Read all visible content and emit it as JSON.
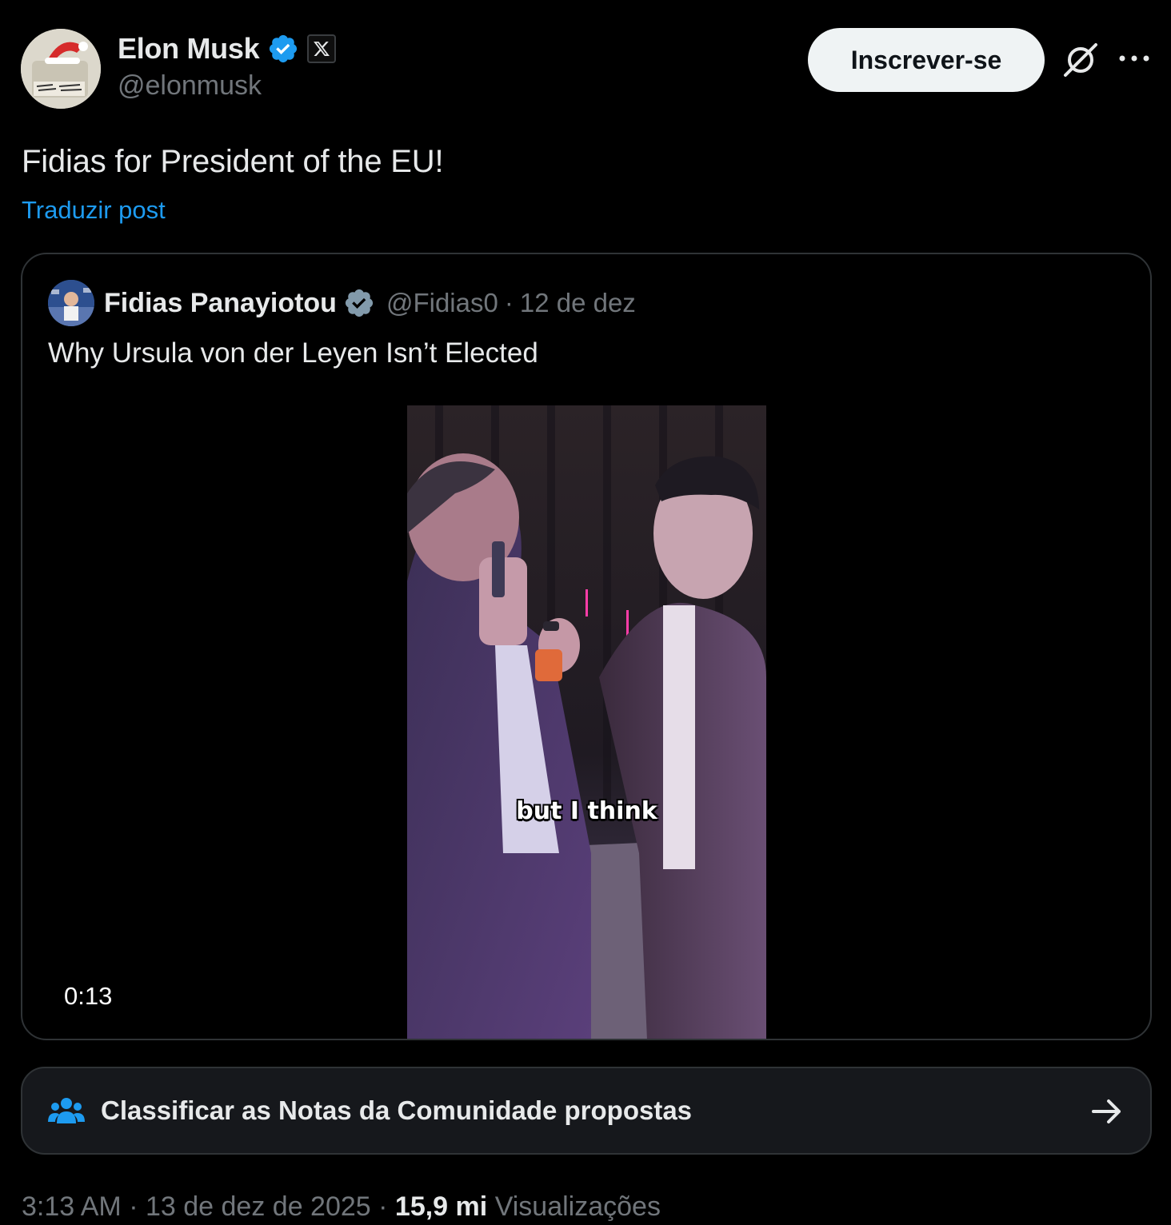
{
  "author": {
    "name": "Elon Musk",
    "handle": "@elonmusk"
  },
  "header": {
    "subscribe_label": "Inscrever-se"
  },
  "post": {
    "text": "Fidias for President of the EU!",
    "translate_label": "Traduzir post"
  },
  "quote": {
    "name": "Fidias Panayiotou",
    "handle": "@Fidias0",
    "separator": "·",
    "date": "12 de dez",
    "text": "Why Ursula von der Leyen Isn’t Elected",
    "video": {
      "caption": "but I think",
      "duration": "0:13"
    }
  },
  "community_notes": {
    "label": "Classificar as Notas da Comunidade propostas"
  },
  "meta": {
    "time": "3:13 AM",
    "sep1": "·",
    "date": "13 de dez de 2025",
    "sep2": "·",
    "views_count": "15,9 mi",
    "views_label": "Visualizações"
  },
  "icons": {
    "verified": "verified-badge-icon",
    "x_badge": "x-logo-icon",
    "grok": "grok-icon",
    "more": "more-icon",
    "community": "people-icon",
    "arrow": "arrow-right-icon"
  },
  "colors": {
    "background": "#000000",
    "text_primary": "#e7e9ea",
    "text_secondary": "#71767b",
    "link": "#1d9bf0",
    "border": "#2f3336",
    "verified_blue": "#1d9bf0",
    "verified_gray": "#829aab"
  }
}
